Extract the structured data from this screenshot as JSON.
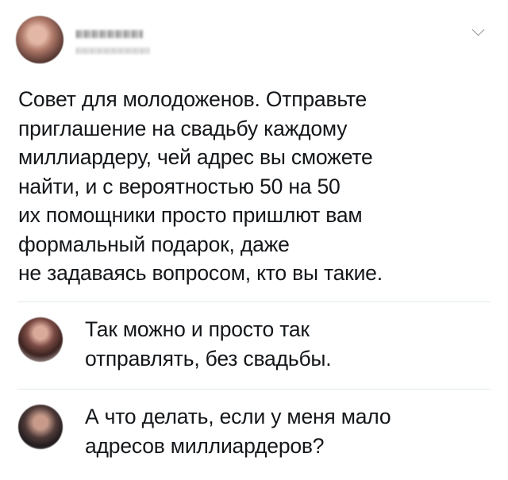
{
  "tweet": {
    "lines": [
      "Совет для молодоженов. Отправьте",
      "приглашение на свадьбу каждому",
      "миллиардеру, чей адрес вы сможете",
      "найти, и с вероятностью 50 на 50",
      "их помощники просто пришлют вам",
      "формальный подарок, даже",
      "не задаваясь вопросом, кто вы такие."
    ],
    "icon": "chevron-down-icon"
  },
  "replies": [
    {
      "lines": [
        "Так можно и просто так",
        "отправлять, без свадьбы."
      ]
    },
    {
      "lines": [
        "А что делать, если у меня мало",
        "адресов миллиардеров?"
      ]
    }
  ],
  "colors": {
    "text": "#14171a",
    "divider": "#e1e8ed",
    "chevron": "#8a8f94"
  }
}
